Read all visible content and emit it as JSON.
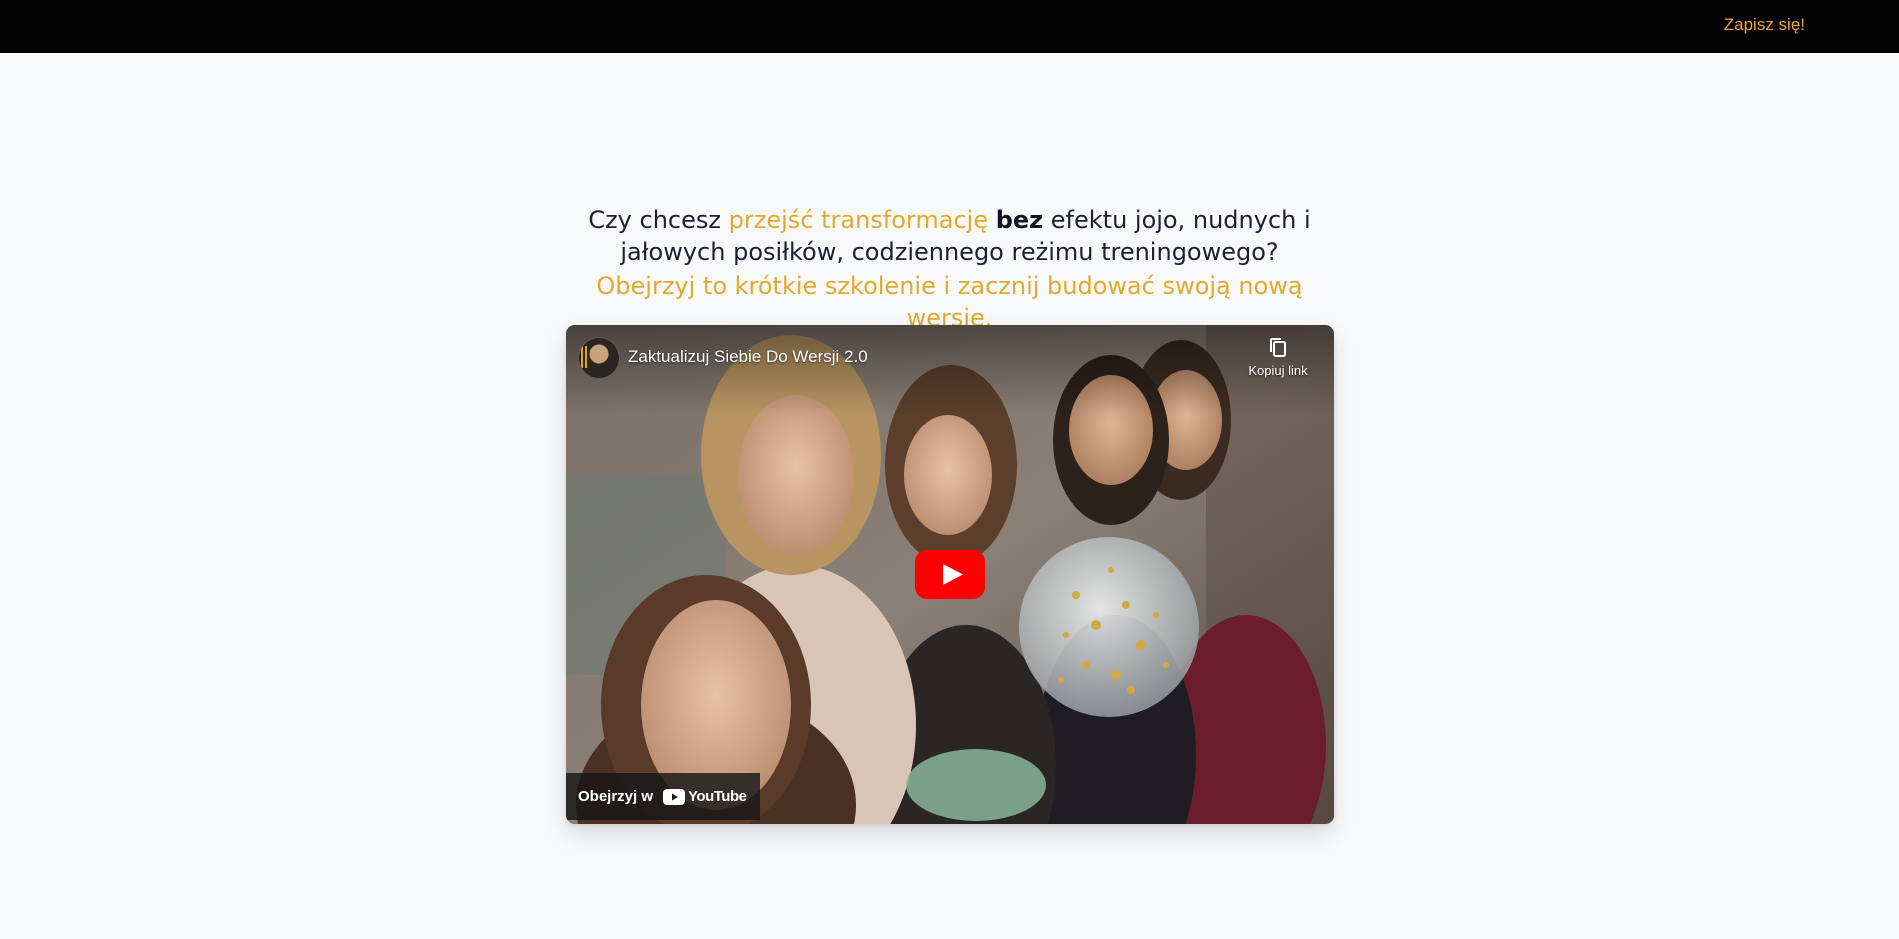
{
  "header": {
    "signup_label": "Zapisz się!"
  },
  "hero": {
    "headline_part1": "Czy chcesz ",
    "headline_accent": "przejść transformację",
    "headline_space": " ",
    "headline_bold": "bez",
    "headline_part2": " efektu jojo, nudnych i jałowych posiłków, codziennego reżimu treningowego?",
    "subline": "Obejrzyj to krótkie szkolenie i zacznij budować swoją nową wersję."
  },
  "video": {
    "title": "Zaktualizuj Siebie Do Wersji 2.0",
    "copy_link_label": "Kopiuj link",
    "watch_on_label": "Obejrzyj w",
    "youtube_wordmark": "YouTube"
  },
  "colors": {
    "accent": "#e2aa2c",
    "signup": "#f0a53c",
    "topbar": "#020202",
    "background": "#f8f9fb",
    "youtube_red": "#ff0000"
  }
}
